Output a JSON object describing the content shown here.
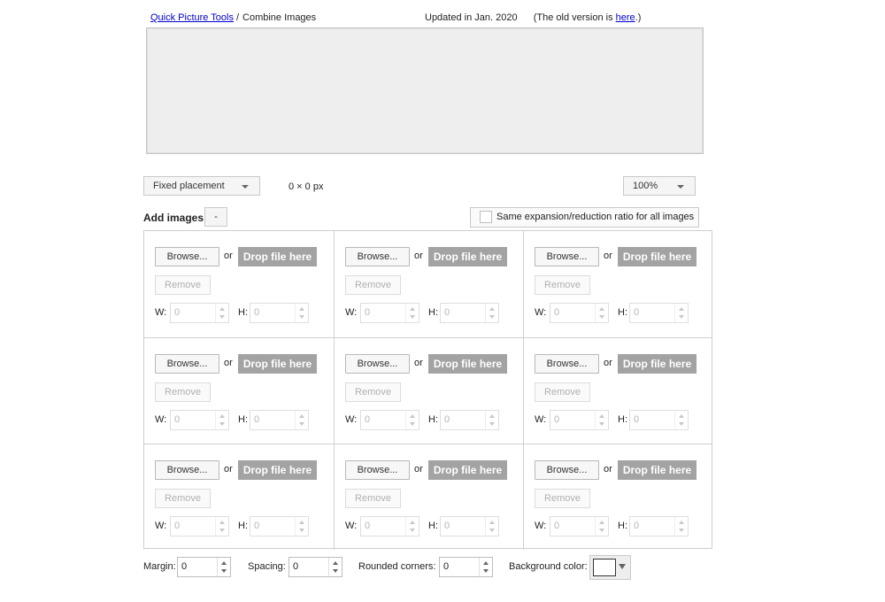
{
  "header": {
    "breadcrumb_link": "Quick Picture Tools",
    "breadcrumb_sep": "/",
    "breadcrumb_current": "Combine Images",
    "updated_text": "Updated in Jan. 2020",
    "old_version_prefix": "(The old version is ",
    "old_version_link": "here",
    "old_version_suffix": ".)"
  },
  "toolbar": {
    "placement_value": "Fixed placement",
    "size_readout": "0 × 0 px",
    "zoom_value": "100%"
  },
  "add_images": {
    "label": "Add images",
    "minus_label": "-",
    "same_ratio_label": "Same expansion/reduction ratio for all images"
  },
  "slot": {
    "browse_label": "Browse...",
    "or_label": "or",
    "drop_label": "Drop file here",
    "remove_label": "Remove",
    "w_label": "W:",
    "h_label": "H:",
    "w_value": "0",
    "h_value": "0"
  },
  "bottom": {
    "margin_label": "Margin:",
    "margin_value": "0",
    "spacing_label": "Spacing:",
    "spacing_value": "0",
    "corners_label": "Rounded corners:",
    "corners_value": "0",
    "bg_label": "Background color:",
    "bg_color": "#ffffff"
  },
  "colors": {
    "drop_bg": "#a3a3a3",
    "preview_bg": "#eeeeee",
    "link": "#0000cc"
  }
}
